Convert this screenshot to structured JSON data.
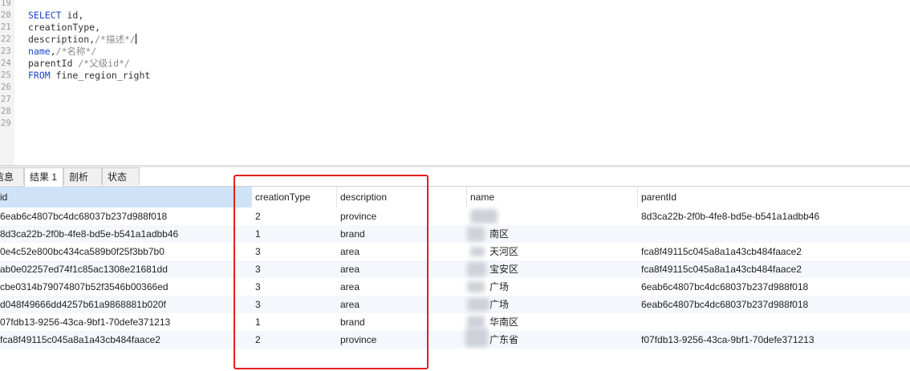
{
  "editor": {
    "lines": [
      {
        "no": "19",
        "segments": []
      },
      {
        "no": "20",
        "segments": [
          {
            "t": "SELECT",
            "c": "kw"
          },
          {
            "t": " id,",
            "c": "tx"
          }
        ]
      },
      {
        "no": "21",
        "segments": [
          {
            "t": "creationType,",
            "c": "tx"
          }
        ]
      },
      {
        "no": "22",
        "segments": [
          {
            "t": "description,",
            "c": "tx"
          },
          {
            "t": "/*描述*/",
            "c": "cm"
          }
        ],
        "cursor": true
      },
      {
        "no": "23",
        "segments": [
          {
            "t": "name",
            "c": "kw"
          },
          {
            "t": ",",
            "c": "tx"
          },
          {
            "t": "/*名称*/",
            "c": "cm"
          }
        ]
      },
      {
        "no": "24",
        "segments": [
          {
            "t": "parentId ",
            "c": "tx"
          },
          {
            "t": "/*父级id*/",
            "c": "cm"
          }
        ]
      },
      {
        "no": "25",
        "segments": [
          {
            "t": "FROM",
            "c": "kw"
          },
          {
            "t": " fine_region_right",
            "c": "tx"
          }
        ]
      },
      {
        "no": "26",
        "segments": []
      },
      {
        "no": "27",
        "segments": []
      },
      {
        "no": "28",
        "segments": []
      },
      {
        "no": "29",
        "segments": []
      }
    ]
  },
  "tabs": [
    "信息",
    "结果 1",
    "剖析",
    "状态"
  ],
  "columns": [
    "id",
    "creationType",
    "description",
    "name",
    "parentId"
  ],
  "rows": [
    {
      "id": "6eab6c4807bc4dc68037b237d988f018",
      "creationType": "2",
      "description": "province",
      "name": "",
      "parentId": "8d3ca22b-2f0b-4fe8-bd5e-b541a1adbb46"
    },
    {
      "id": "8d3ca22b-2f0b-4fe8-bd5e-b541a1adbb46",
      "creationType": "1",
      "description": "brand",
      "name": "南区",
      "parentId": ""
    },
    {
      "id": "0e4c52e800bc434ca589b0f25f3bb7b0",
      "creationType": "3",
      "description": "area",
      "name": "天河区",
      "parentId": "fca8f49115c045a8a1a43cb484faace2"
    },
    {
      "id": "ab0e02257ed74f1c85ac1308e21681dd",
      "creationType": "3",
      "description": "area",
      "name": "宝安区",
      "parentId": "fca8f49115c045a8a1a43cb484faace2"
    },
    {
      "id": "cbe0314b79074807b52f3546b00366ed",
      "creationType": "3",
      "description": "area",
      "name": "广场",
      "parentId": "6eab6c4807bc4dc68037b237d988f018"
    },
    {
      "id": "d048f49666dd4257b61a9868881b020f",
      "creationType": "3",
      "description": "area",
      "name": "广场",
      "parentId": "6eab6c4807bc4dc68037b237d988f018"
    },
    {
      "id": "07fdb13-9256-43ca-9bf1-70defe371213",
      "creationType": "1",
      "description": "brand",
      "name": "华南区",
      "parentId": ""
    },
    {
      "id": "fca8f49115c045a8a1a43cb484faace2",
      "creationType": "2",
      "description": "province",
      "name": "广东省",
      "parentId": "f07fdb13-9256-43ca-9bf1-70defe371213"
    }
  ],
  "colors": {
    "highlight": "#e02020",
    "keyword": "#1b45c4",
    "comment": "#8a8a8a",
    "selected_header": "#cfe3f7"
  }
}
